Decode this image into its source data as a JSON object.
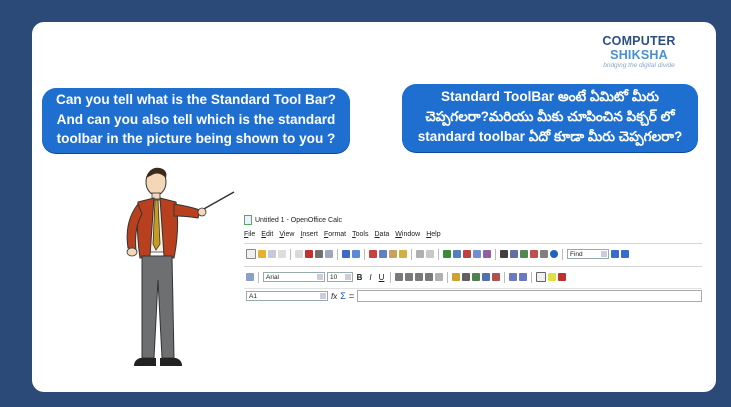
{
  "logo": {
    "name_part1": "COMPUTER ",
    "name_part2": "SHIKSHA",
    "tagline": "bridging the digital divide"
  },
  "question_en": {
    "line1": "Can you tell what is the Standard Tool Bar?",
    "line2": "And can you also tell which is the standard",
    "line3": "toolbar in the picture being shown to you ?"
  },
  "question_te": {
    "line1": "Standard ToolBar అంటే ఏమిటో మీరు",
    "line2": "చెప్పగలరా?మరియు మీకు చూపించిన పిక్చర్ లో",
    "line3": "standard toolbar ఏదో కూడా మీరు చెప్పగలరా?"
  },
  "app": {
    "title": "Untitled 1 - OpenOffice Calc",
    "menu": [
      "File",
      "Edit",
      "View",
      "Insert",
      "Format",
      "Tools",
      "Data",
      "Window",
      "Help"
    ],
    "find_placeholder": "Find",
    "font_name": "Arial",
    "font_size": "10",
    "bold": "B",
    "italic": "I",
    "underline": "U",
    "cell_ref": "A1",
    "fx": "fx",
    "sum": "Σ",
    "equals": "="
  },
  "colors": {
    "background": "#2b4a78",
    "bubble": "#1e6fd0"
  }
}
